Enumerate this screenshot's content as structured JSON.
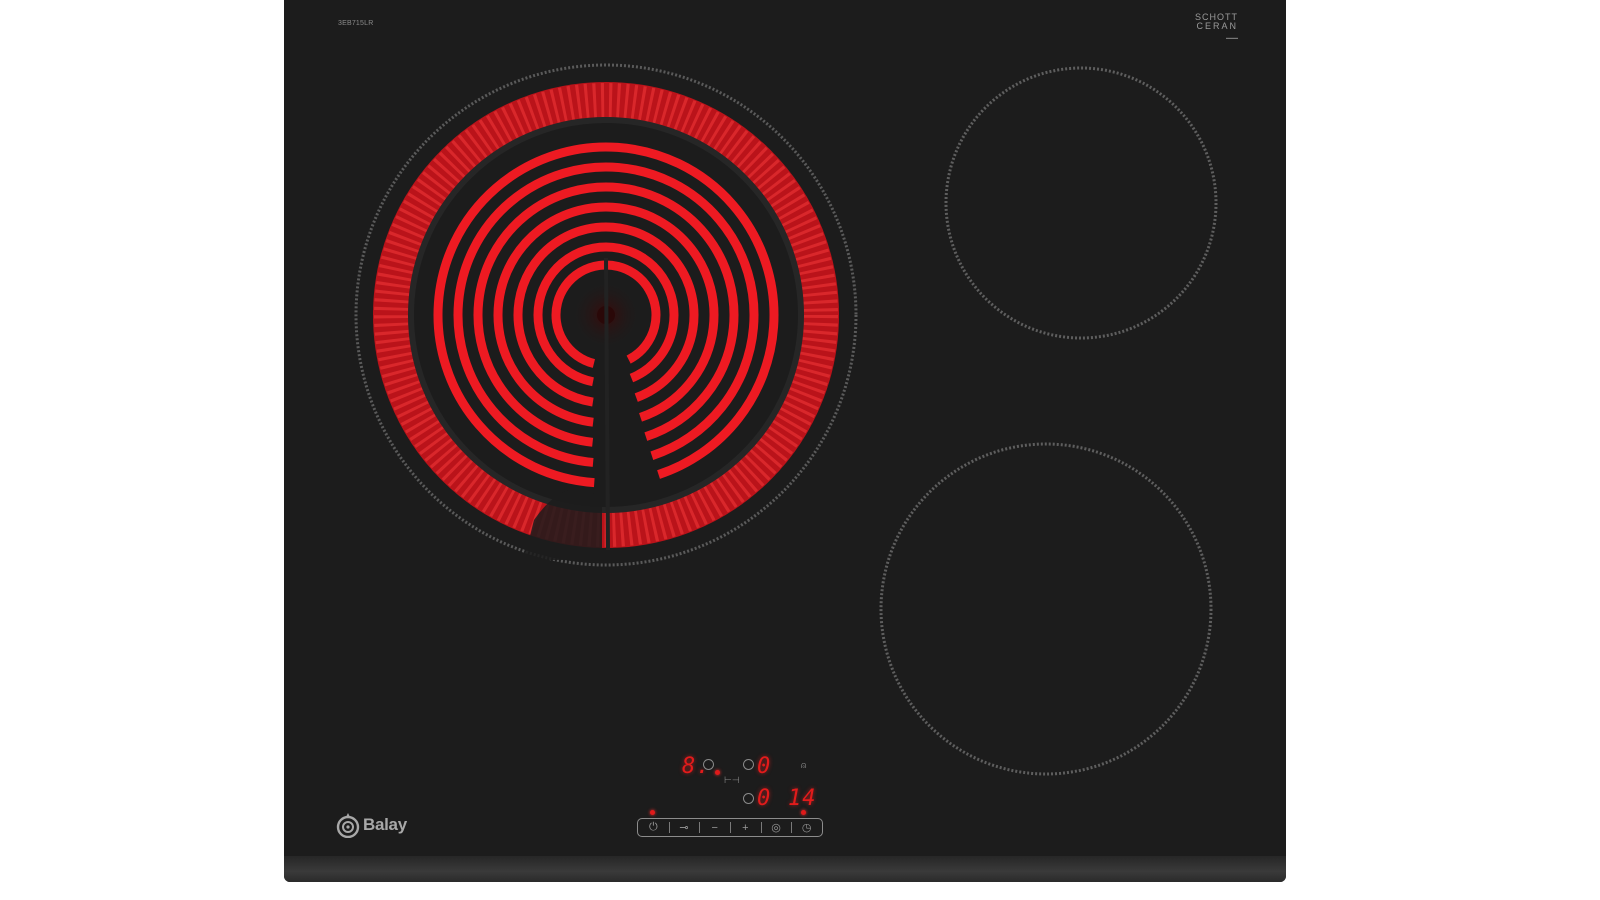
{
  "product": {
    "model": "3EB715LR",
    "surface_brand_line1": "SCHOTT",
    "surface_brand_line2": "CERAN",
    "brand": "Balay"
  },
  "zones": [
    {
      "id": "front-left",
      "state": "heating"
    },
    {
      "id": "back-right",
      "state": "off"
    },
    {
      "id": "front-right",
      "state": "off"
    }
  ],
  "control_panel": {
    "display_power_level": "8.",
    "display_zone_level": "0",
    "display_timer_left": "0",
    "display_timer_right": "14",
    "buttons": [
      {
        "name": "power-button",
        "icon": "power-icon",
        "glyph": "⏻"
      },
      {
        "name": "child-lock-button",
        "icon": "key-icon",
        "glyph": "⊸"
      },
      {
        "name": "minus-button",
        "icon": "minus-icon",
        "glyph": "−"
      },
      {
        "name": "plus-button",
        "icon": "plus-icon",
        "glyph": "+"
      },
      {
        "name": "zone-select-button",
        "icon": "zone-icon",
        "glyph": "◎"
      },
      {
        "name": "timer-button",
        "icon": "clock-icon",
        "glyph": "◷"
      }
    ]
  },
  "colors": {
    "glass": "#1c1c1c",
    "heating_red": "#e8141e",
    "display_red": "#e21b1b"
  }
}
